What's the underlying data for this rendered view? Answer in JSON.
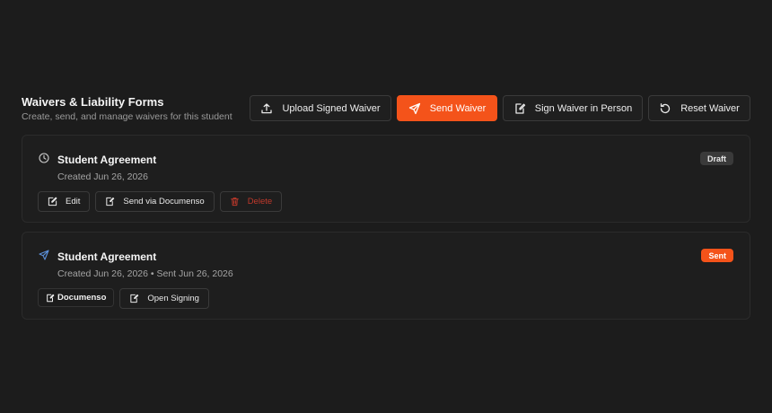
{
  "header": {
    "title": "Waivers & Liability Forms",
    "subtitle": "Create, send, and manage waivers for this student"
  },
  "actions": {
    "upload_label": "Upload Signed Waiver",
    "send_label": "Send Waiver",
    "sign_label": "Sign Waiver in Person",
    "reset_label": "Reset Waiver"
  },
  "waivers": [
    {
      "title": "Student Agreement",
      "meta": "Created Jun 26, 2026",
      "status": "Draft",
      "actions": {
        "edit": "Edit",
        "send_documenso": "Send via Documenso",
        "delete": "Delete"
      }
    },
    {
      "title": "Student Agreement",
      "meta": "Created Jun 26, 2026 • Sent Jun 26, 2026",
      "status": "Sent",
      "provider": "Documenso",
      "actions": {
        "open_signing": "Open Signing"
      }
    }
  ],
  "colors": {
    "accent": "#f4531a",
    "background": "#1c1c1c",
    "danger": "#c0392b",
    "sent_icon": "#5b8fd8"
  },
  "icons": {
    "upload": "upload-icon",
    "send": "paper-plane-icon",
    "sign": "sign-document-icon",
    "reset": "reset-icon",
    "draft_status": "clock-icon",
    "sent_status": "paper-plane-icon",
    "edit": "edit-icon",
    "delete": "trash-icon"
  }
}
